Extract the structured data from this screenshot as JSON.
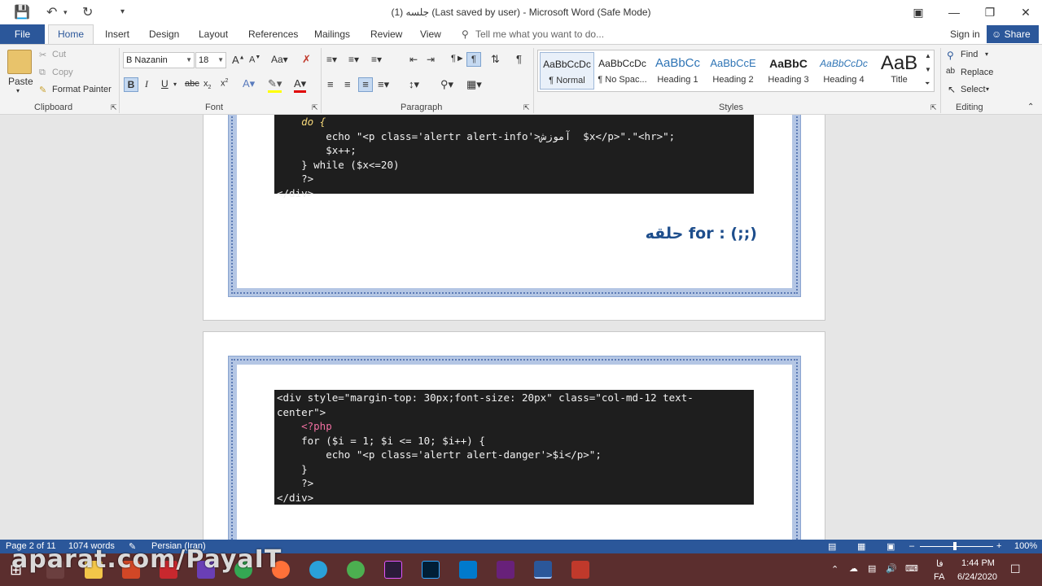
{
  "window": {
    "title": "جلسه (1)  (Last saved by user) - Microsoft Word (Safe Mode)",
    "controls": [
      "restore-ribbon",
      "minimize",
      "maximize",
      "close"
    ]
  },
  "tabs": {
    "file": "File",
    "home": "Home",
    "items": [
      "Insert",
      "Design",
      "Layout",
      "References",
      "Mailings",
      "Review",
      "View"
    ],
    "tell_me": "Tell me what you want to do...",
    "sign_in": "Sign in",
    "share": "Share"
  },
  "ribbon": {
    "clipboard": {
      "label": "Clipboard",
      "paste": "Paste",
      "cut": "Cut",
      "copy": "Copy",
      "format_painter": "Format Painter"
    },
    "font": {
      "label": "Font",
      "name": "B Nazanin",
      "size": "18"
    },
    "paragraph": {
      "label": "Paragraph"
    },
    "styles": {
      "label": "Styles",
      "items": [
        {
          "sample": "AaBbCcDc",
          "name": "¶ Normal"
        },
        {
          "sample": "AaBbCcDc",
          "name": "¶ No Spac..."
        },
        {
          "sample": "AaBbCc",
          "name": "Heading 1"
        },
        {
          "sample": "AaBbCcE",
          "name": "Heading 2"
        },
        {
          "sample": "AaBbC",
          "name": "Heading 3"
        },
        {
          "sample": "AaBbCcDc",
          "name": "Heading 4"
        },
        {
          "sample": "AaB",
          "name": "Title"
        }
      ]
    },
    "editing": {
      "label": "Editing",
      "find": "Find",
      "replace": "Replace",
      "select": "Select"
    }
  },
  "document": {
    "page1_code_lines": [
      "    do {",
      "        echo \"<p class='alertr alert-info'>آموزش  $x</p>\".\"<hr>\";",
      "        $x++;",
      "    } while ($x<=20)",
      "    ?>",
      "</div>"
    ],
    "heading": "حلقه  for : (;;)",
    "page2_code_lines": [
      "<div style=\"margin-top: 30px;font-size: 20px\" class=\"col-md-12 text-",
      "center\">",
      "    <?php",
      "    for ($i = 1; $i <= 10; $i++) {",
      "        echo \"<p class='alertr alert-danger'>$i</p>\";",
      "    }",
      "    ?>",
      "</div>"
    ]
  },
  "status": {
    "page": "Page 2 of 11",
    "words": "1074 words",
    "language": "Persian (Iran)",
    "zoom": "100%"
  },
  "taskbar": {
    "time": "1:44 PM",
    "date": "6/24/2020",
    "lang": "FA",
    "lang_top": "فا"
  },
  "watermark": "aparat.com/PayaIT",
  "colors": {
    "word_blue": "#2b579a",
    "taskbar": "#5b2e2e",
    "code_bg": "#1e1e1e",
    "heading": "#1e4e8c"
  }
}
